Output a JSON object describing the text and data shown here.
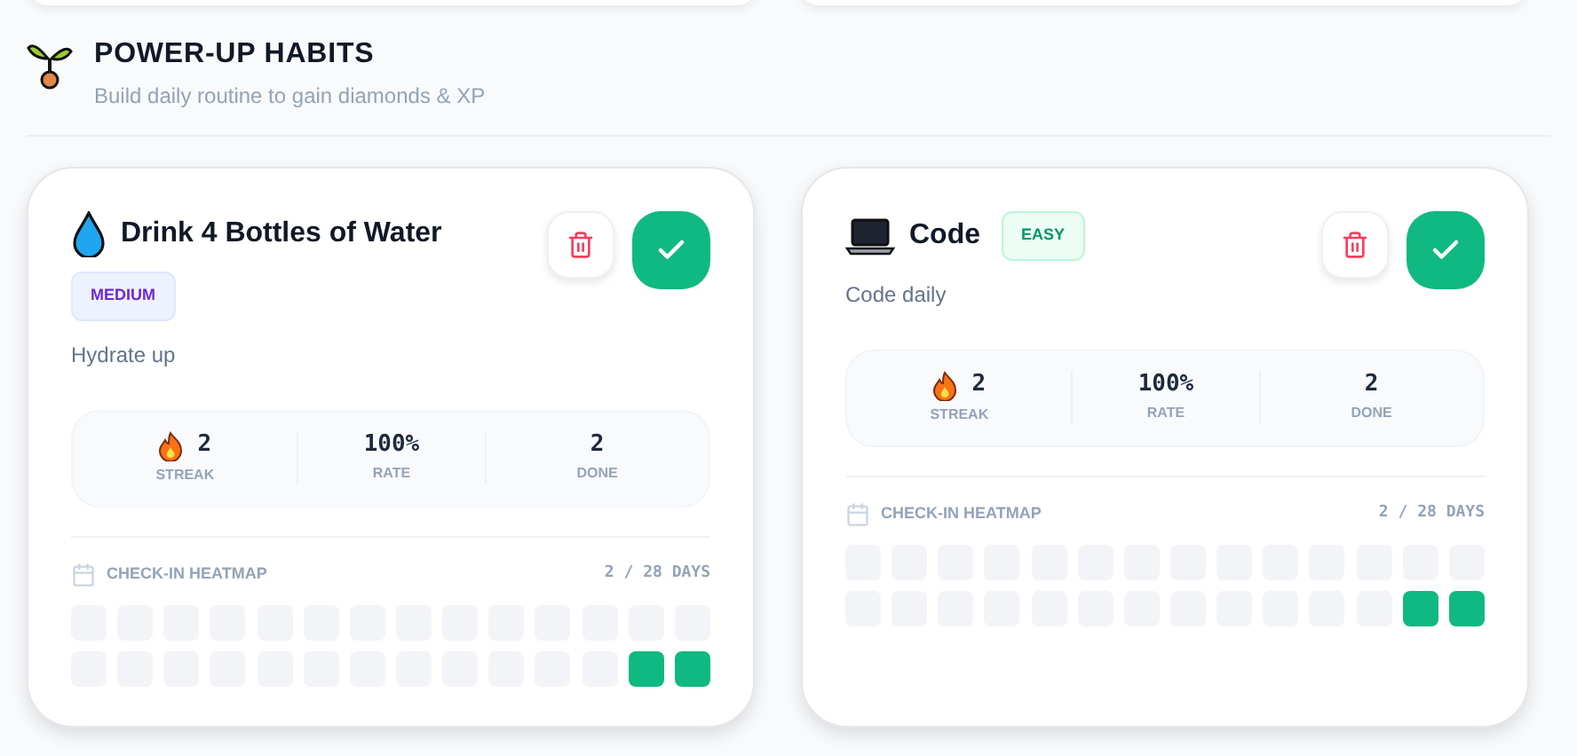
{
  "section": {
    "title": "POWER-UP HABITS",
    "subtitle": "Build daily routine to gain diamonds & XP"
  },
  "habits": [
    {
      "kind": "drop",
      "title": "Drink 4 Bottles of Water",
      "badge": {
        "label": "MEDIUM",
        "kind": "medium"
      },
      "description": "Hydrate up",
      "completed": true,
      "stats": [
        {
          "kind": "streak",
          "value": "2",
          "label": "STREAK"
        },
        {
          "kind": "plain",
          "value": "100%",
          "label": "RATE"
        },
        {
          "kind": "plain",
          "value": "2",
          "label": "DONE"
        }
      ],
      "heatmap": {
        "title": "CHECK-IN HEATMAP",
        "count": "2 / 28 DAYS",
        "days": [
          {
            "checked": false
          },
          {
            "checked": false
          },
          {
            "checked": false
          },
          {
            "checked": false
          },
          {
            "checked": false
          },
          {
            "checked": false
          },
          {
            "checked": false
          },
          {
            "checked": false
          },
          {
            "checked": false
          },
          {
            "checked": false
          },
          {
            "checked": false
          },
          {
            "checked": false
          },
          {
            "checked": false
          },
          {
            "checked": false
          },
          {
            "checked": false
          },
          {
            "checked": false
          },
          {
            "checked": false
          },
          {
            "checked": false
          },
          {
            "checked": false
          },
          {
            "checked": false
          },
          {
            "checked": false
          },
          {
            "checked": false
          },
          {
            "checked": false
          },
          {
            "checked": false
          },
          {
            "checked": false
          },
          {
            "checked": false
          },
          {
            "checked": true
          },
          {
            "checked": true
          }
        ]
      }
    },
    {
      "kind": "laptop",
      "title": "Code",
      "badge": {
        "label": "EASY",
        "kind": "easy"
      },
      "description": "Code daily",
      "completed": true,
      "stats": [
        {
          "kind": "streak",
          "value": "2",
          "label": "STREAK"
        },
        {
          "kind": "plain",
          "value": "100%",
          "label": "RATE"
        },
        {
          "kind": "plain",
          "value": "2",
          "label": "DONE"
        }
      ],
      "heatmap": {
        "title": "CHECK-IN HEATMAP",
        "count": "2 / 28 DAYS",
        "days": [
          {
            "checked": false
          },
          {
            "checked": false
          },
          {
            "checked": false
          },
          {
            "checked": false
          },
          {
            "checked": false
          },
          {
            "checked": false
          },
          {
            "checked": false
          },
          {
            "checked": false
          },
          {
            "checked": false
          },
          {
            "checked": false
          },
          {
            "checked": false
          },
          {
            "checked": false
          },
          {
            "checked": false
          },
          {
            "checked": false
          },
          {
            "checked": false
          },
          {
            "checked": false
          },
          {
            "checked": false
          },
          {
            "checked": false
          },
          {
            "checked": false
          },
          {
            "checked": false
          },
          {
            "checked": false
          },
          {
            "checked": false
          },
          {
            "checked": false
          },
          {
            "checked": false
          },
          {
            "checked": false
          },
          {
            "checked": false
          },
          {
            "checked": true
          },
          {
            "checked": true
          }
        ]
      }
    }
  ]
}
